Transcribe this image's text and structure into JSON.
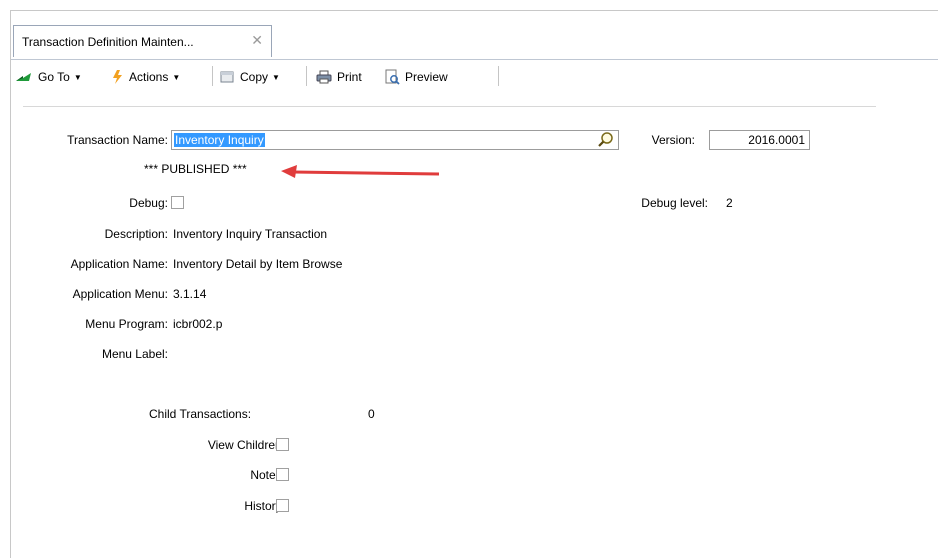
{
  "tab": {
    "title": "Transaction Definition Mainten...",
    "close": "✕"
  },
  "toolbar": {
    "goto": "Go To",
    "actions": "Actions",
    "copy": "Copy",
    "print": "Print",
    "preview": "Preview",
    "dropdown_glyph": "▼"
  },
  "form": {
    "transaction_name_label": "Transaction Name:",
    "transaction_name_value": "Inventory Inquiry",
    "version_label": "Version:",
    "version_value": "2016.0001",
    "published_text": "*** PUBLISHED ***",
    "debug_label": "Debug:",
    "debug_checked": false,
    "debug_level_label": "Debug level:",
    "debug_level_value": "2",
    "description_label": "Description:",
    "description_value": "Inventory Inquiry Transaction",
    "application_name_label": "Application Name:",
    "application_name_value": "Inventory Detail by Item Browse",
    "application_menu_label": "Application Menu:",
    "application_menu_value": "3.1.14",
    "menu_program_label": "Menu Program:",
    "menu_program_value": "icbr002.p",
    "menu_label_label": "Menu Label:",
    "menu_label_value": "",
    "child_transactions_label": "Child Transactions:",
    "child_transactions_value": "0",
    "view_children_label": "View Children:",
    "notes_label": "Notes:",
    "history_label": "History:"
  },
  "colors": {
    "selection": "#3399ff",
    "arrow": "#e03c3c",
    "goto_icon": "#1f9a3a",
    "actions_icon": "#f2a120"
  }
}
